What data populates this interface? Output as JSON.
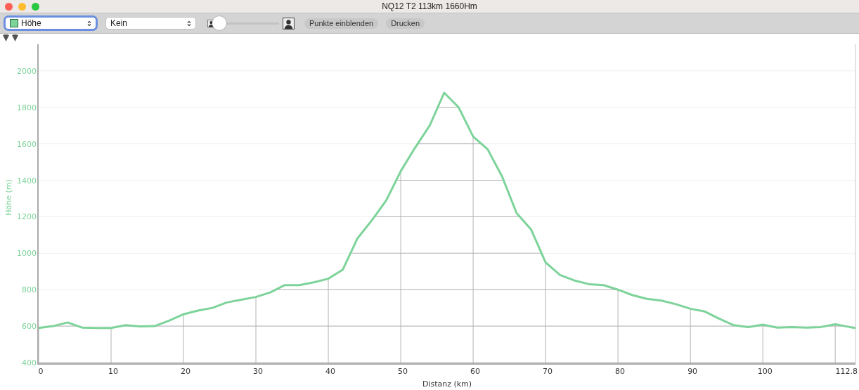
{
  "window": {
    "title": "NQ12 T2 113km 1660Hm"
  },
  "toolbar": {
    "series_select": {
      "value": "Höhe",
      "color": "#7dd39a"
    },
    "second_select": {
      "value": "Kein"
    },
    "zoom_slider": {
      "level": 0
    },
    "buttons": [
      "Punkte einblenden",
      "Drucken"
    ]
  },
  "chart": {
    "chart_data": {
      "type": "line",
      "xlabel": "Distanz (km)",
      "ylabel": "Höhe (m)",
      "x": [
        0,
        2,
        4,
        6,
        8,
        10,
        12,
        14,
        16,
        18,
        20,
        22,
        24,
        26,
        28,
        30,
        32,
        34,
        36,
        38,
        40,
        42,
        44,
        46,
        48,
        50,
        52,
        54,
        56,
        58,
        60,
        62,
        64,
        66,
        68,
        70,
        72,
        74,
        76,
        78,
        80,
        82,
        84,
        86,
        88,
        90,
        92,
        94,
        96,
        98,
        100,
        102,
        104,
        106,
        108,
        110,
        112,
        112.8
      ],
      "series": [
        {
          "color": "#7dd39a",
          "values": [
            590,
            600,
            620,
            592,
            590,
            590,
            605,
            598,
            600,
            630,
            665,
            685,
            700,
            730,
            745,
            760,
            785,
            825,
            825,
            840,
            860,
            910,
            1080,
            1180,
            1290,
            1450,
            1580,
            1700,
            1880,
            1800,
            1640,
            1570,
            1420,
            1220,
            1130,
            950,
            880,
            850,
            830,
            825,
            800,
            770,
            750,
            740,
            720,
            695,
            680,
            640,
            605,
            595,
            608,
            592,
            595,
            592,
            595,
            610,
            595,
            590
          ]
        }
      ],
      "grid": true,
      "xlim": [
        0,
        112.8
      ],
      "ylim": [
        396,
        2146
      ],
      "xticks": [
        0,
        10,
        20,
        30,
        40,
        50,
        60,
        70,
        80,
        90,
        100,
        {
          "value": 112.8,
          "label": "112.8"
        }
      ],
      "yticks": [
        400,
        600,
        800,
        1000,
        1200,
        1400,
        1600,
        1800,
        2000
      ]
    }
  }
}
